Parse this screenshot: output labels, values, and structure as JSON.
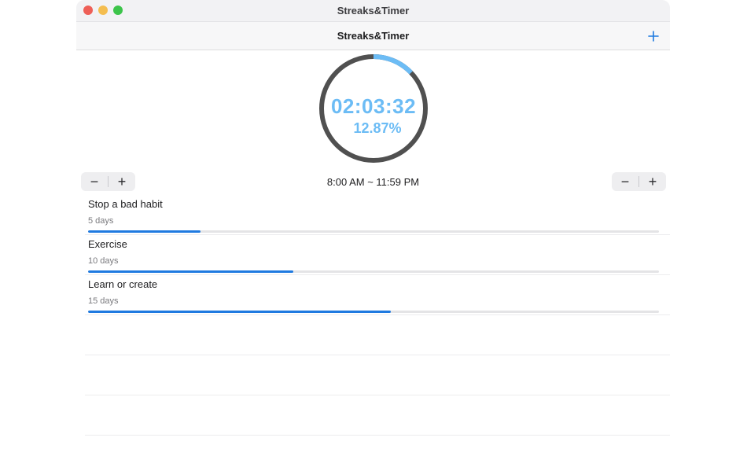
{
  "window": {
    "title": "Streaks&Timer"
  },
  "navbar": {
    "title": "Streaks&Timer",
    "add_icon": "plus-icon"
  },
  "timer": {
    "time": "02:03:32",
    "percent_label": "12.87%",
    "progress": 0.1287,
    "colors": {
      "ring": "#505050",
      "progress": "#6cbcf5"
    }
  },
  "schedule": {
    "range": "8:00 AM ~ 11:59 PM",
    "left_stepper": {
      "minus": "−",
      "plus": "+"
    },
    "right_stepper": {
      "minus": "−",
      "plus": "+"
    }
  },
  "habits": [
    {
      "name": "Stop a bad habit",
      "days": "5 days",
      "progress": 0.197
    },
    {
      "name": "Exercise",
      "days": "10 days",
      "progress": 0.36
    },
    {
      "name": "Learn or create",
      "days": "15 days",
      "progress": 0.53
    }
  ],
  "colors": {
    "accent": "#1f7ae0",
    "ring_light": "#6cbcf5"
  }
}
